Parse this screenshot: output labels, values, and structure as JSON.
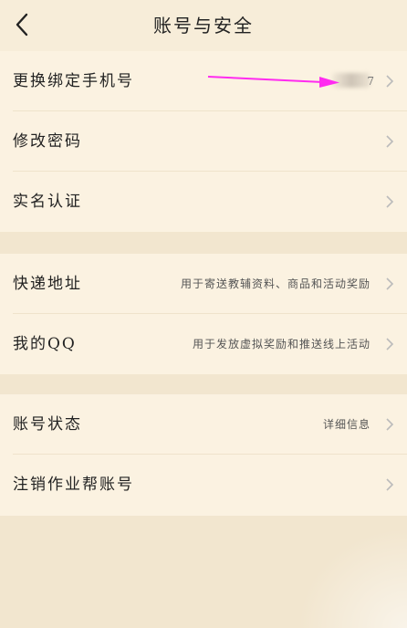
{
  "header": {
    "title": "账号与安全"
  },
  "group1": {
    "items": [
      {
        "label": "更换绑定手机号",
        "detail": "7"
      },
      {
        "label": "修改密码"
      },
      {
        "label": "实名认证"
      }
    ]
  },
  "group2": {
    "items": [
      {
        "label": "快递地址",
        "detail": "用于寄送教辅资料、商品和活动奖励"
      },
      {
        "label": "我的QQ",
        "detail": "用于发放虚拟奖励和推送线上活动"
      }
    ]
  },
  "group3": {
    "items": [
      {
        "label": "账号状态",
        "detail": "详细信息"
      },
      {
        "label": "注销作业帮账号"
      }
    ]
  },
  "colors": {
    "background": "#f7edd9",
    "row_background": "#fbf2e1",
    "annotation_arrow": "#ff2bf0"
  },
  "icons": {
    "back": "chevron-left-icon",
    "row_chevron": "chevron-right-icon"
  }
}
